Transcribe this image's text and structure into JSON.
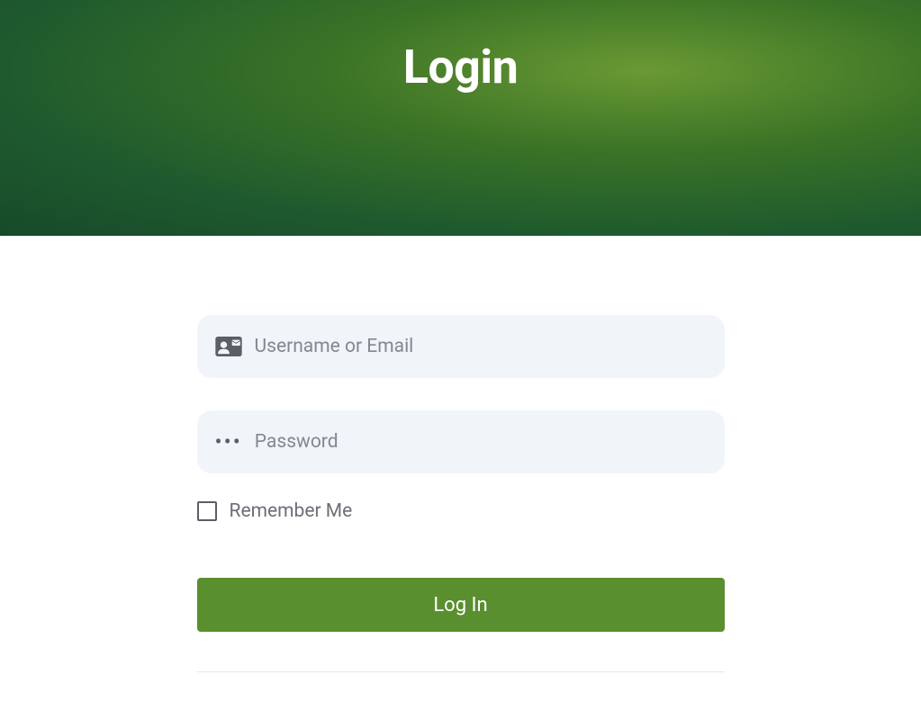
{
  "hero": {
    "title": "Login"
  },
  "form": {
    "username": {
      "placeholder": "Username or Email",
      "value": ""
    },
    "password": {
      "placeholder": "Password",
      "value": ""
    },
    "remember": {
      "label": "Remember Me",
      "checked": false
    },
    "submit": {
      "label": "Log In"
    }
  }
}
